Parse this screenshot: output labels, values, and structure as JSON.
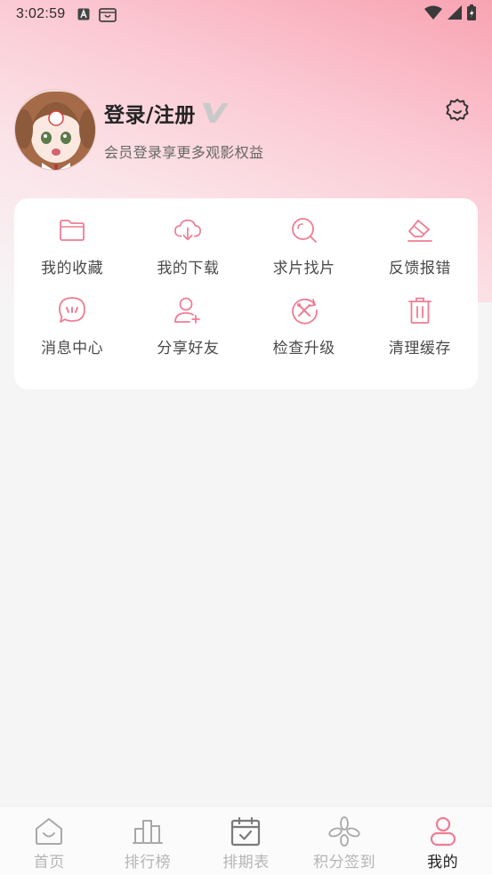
{
  "status_bar": {
    "time": "3:02:59",
    "icons": [
      "notification-a-icon",
      "shopping-bag-icon",
      "wifi-icon",
      "signal-icon",
      "battery-icon"
    ]
  },
  "profile": {
    "title": "登录/注册",
    "subtitle": "会员登录享更多观影权益",
    "vip_badge": "V"
  },
  "menu": [
    {
      "label": "我的收藏",
      "icon": "folder-icon"
    },
    {
      "label": "我的下载",
      "icon": "cloud-download-icon"
    },
    {
      "label": "求片找片",
      "icon": "search-icon"
    },
    {
      "label": "反馈报错",
      "icon": "eraser-icon"
    },
    {
      "label": "消息中心",
      "icon": "message-icon"
    },
    {
      "label": "分享好友",
      "icon": "add-user-icon"
    },
    {
      "label": "检查升级",
      "icon": "update-tools-icon"
    },
    {
      "label": "清理缓存",
      "icon": "trash-icon"
    }
  ],
  "bottom_nav": [
    {
      "label": "首页",
      "icon": "home-icon",
      "active": false
    },
    {
      "label": "排行榜",
      "icon": "ranking-icon",
      "active": false
    },
    {
      "label": "排期表",
      "icon": "calendar-icon",
      "active": false
    },
    {
      "label": "积分签到",
      "icon": "points-icon",
      "active": false
    },
    {
      "label": "我的",
      "icon": "profile-icon",
      "active": true
    }
  ],
  "colors": {
    "accent": "#ee7d94",
    "nav_inactive": "#b5b5b5",
    "nav_active": "#222222"
  }
}
